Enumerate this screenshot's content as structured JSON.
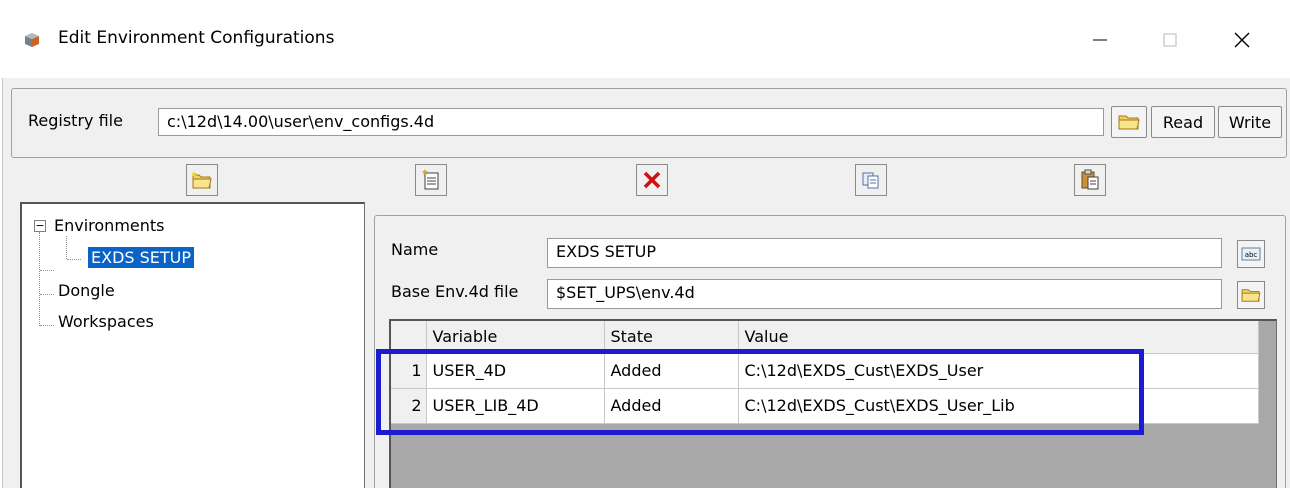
{
  "window": {
    "title": "Edit Environment Configurations",
    "minimize_icon": "minimize-icon",
    "maximize_icon": "maximize-icon",
    "close_icon": "close-icon"
  },
  "registry": {
    "label": "Registry file",
    "value": "c:\\12d\\14.00\\user\\env_configs.4d",
    "read_label": "Read",
    "write_label": "Write"
  },
  "tree": {
    "root": "Environments",
    "child": "EXDS SETUP",
    "items": [
      "Dongle",
      "Workspaces"
    ]
  },
  "details": {
    "name_label": "Name",
    "name_value": "EXDS SETUP",
    "base_label": "Base Env.4d file",
    "base_value": "$SET_UPS\\env.4d"
  },
  "table": {
    "columns": [
      "Variable",
      "State",
      "Value"
    ],
    "rows": [
      {
        "num": "1",
        "variable": "USER_4D",
        "state": "Added",
        "value": "C:\\12d\\EXDS_Cust\\EXDS_User"
      },
      {
        "num": "2",
        "variable": "USER_LIB_4D",
        "state": "Added",
        "value": "C:\\12d\\EXDS_Cust\\EXDS_User_Lib"
      }
    ]
  },
  "colors": {
    "selection": "#0a64c8",
    "highlight_box": "#1b1bd0",
    "grid_background": "#a8a8a8"
  }
}
